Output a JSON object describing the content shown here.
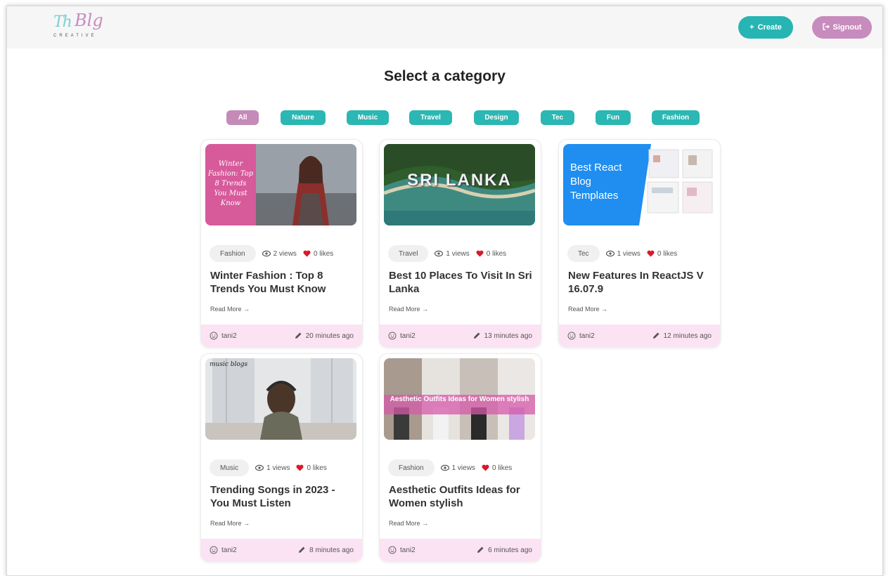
{
  "header": {
    "logo_text": "The Blog",
    "logo_sub": "CREATIVE",
    "create_label": "Create",
    "signout_label": "Signout"
  },
  "page_title": "Select a category",
  "categories": [
    "All",
    "Nature",
    "Music",
    "Travel",
    "Design",
    "Tec",
    "Fun",
    "Fashion"
  ],
  "active_category": "All",
  "colors": {
    "teal": "#27b5b3",
    "pink": "#c88bbd",
    "footer": "#fbe3f3"
  },
  "posts": [
    {
      "tag": "Fashion",
      "views": "2 views",
      "likes": "0 likes",
      "title": "Winter Fashion : Top 8 Trends You Must Know",
      "read_more": "Read More",
      "author": "tani2",
      "time": "20 minutes ago",
      "image_text": "Winter Fashion: Top 8 Trends You Must Know"
    },
    {
      "tag": "Travel",
      "views": "1 views",
      "likes": "0 likes",
      "title": "Best 10 Places To Visit In Sri Lanka",
      "read_more": "Read More",
      "author": "tani2",
      "time": "13 minutes ago",
      "image_text": "SRI LANKA"
    },
    {
      "tag": "Tec",
      "views": "1 views",
      "likes": "0 likes",
      "title": "New Features In ReactJS V 16.07.9",
      "read_more": "Read More",
      "author": "tani2",
      "time": "12 minutes ago",
      "image_text": "Best React Blog Templates"
    },
    {
      "tag": "Music",
      "views": "1 views",
      "likes": "0 likes",
      "title": "Trending Songs in 2023 - You Must Listen",
      "read_more": "Read More",
      "author": "tani2",
      "time": "8 minutes ago",
      "image_text": "music blogs"
    },
    {
      "tag": "Fashion",
      "views": "1 views",
      "likes": "0 likes",
      "title": "Aesthetic Outfits Ideas for Women stylish",
      "read_more": "Read More",
      "author": "tani2",
      "time": "6 minutes ago",
      "image_text": "Aesthetic Outfits Ideas for Women stylish"
    }
  ]
}
